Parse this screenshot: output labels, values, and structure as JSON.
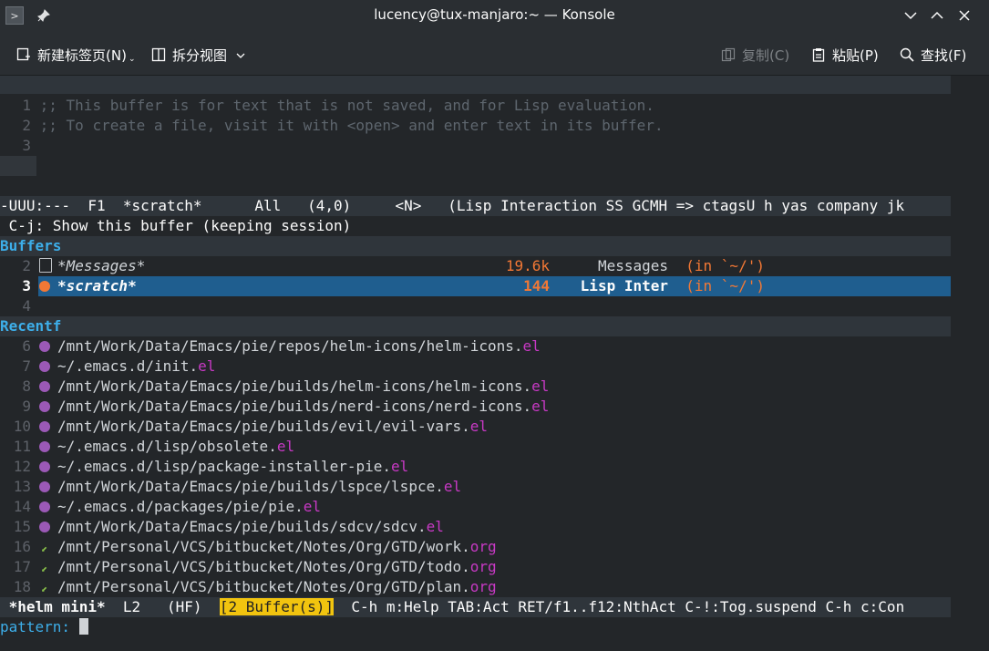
{
  "window": {
    "title": "lucency@tux-manjaro:~ — Konsole",
    "icons": [
      "terminal-icon",
      "pin-icon",
      "minimize-icon",
      "maximize-icon",
      "close-icon"
    ]
  },
  "toolbar": {
    "new_tab": "新建标签页(N)",
    "split_view": "拆分视图",
    "copy": "复制(C)",
    "paste": "粘贴(P)",
    "find": "查找(F)"
  },
  "editor": {
    "lines": [
      {
        "num": "1",
        "text": ";; This buffer is for text that is not saved, and for Lisp evaluation."
      },
      {
        "num": "2",
        "text": ";; To create a file, visit it with <open> and enter text in its buffer."
      },
      {
        "num": "3",
        "text": ""
      }
    ],
    "modeline": "-UUU:---  F1  *scratch*      All   (4,0)     <N>   (Lisp Interaction SS GCMH => ctagsU h yas company jk",
    "hint": " C-j: Show this buffer (keeping session)"
  },
  "helm": {
    "buffers_header": "Buffers",
    "buffers": [
      {
        "num": "2",
        "name": "*Messages*",
        "size": "19.6k",
        "mode": "Messages",
        "dir": "(in `~/')"
      },
      {
        "num": "3",
        "name": "*scratch*",
        "size": "144",
        "mode": "Lisp Inter",
        "dir": "(in `~/')"
      }
    ],
    "blank_num": "4",
    "recentf_header": "Recentf",
    "recentf": [
      {
        "num": "6",
        "path": "/mnt/Work/Data/Emacs/pie/repos/helm-icons/helm-icons.",
        "ext": "el",
        "icon": "elisp-icon"
      },
      {
        "num": "7",
        "path": "~/.emacs.d/init.",
        "ext": "el",
        "icon": "elisp-icon"
      },
      {
        "num": "8",
        "path": "/mnt/Work/Data/Emacs/pie/builds/helm-icons/helm-icons.",
        "ext": "el",
        "icon": "elisp-icon"
      },
      {
        "num": "9",
        "path": "/mnt/Work/Data/Emacs/pie/builds/nerd-icons/nerd-icons.",
        "ext": "el",
        "icon": "elisp-icon"
      },
      {
        "num": "10",
        "path": "/mnt/Work/Data/Emacs/pie/builds/evil/evil-vars.",
        "ext": "el",
        "icon": "elisp-icon"
      },
      {
        "num": "11",
        "path": "~/.emacs.d/lisp/obsolete.",
        "ext": "el",
        "icon": "elisp-icon"
      },
      {
        "num": "12",
        "path": "~/.emacs.d/lisp/package-installer-pie.",
        "ext": "el",
        "icon": "elisp-icon"
      },
      {
        "num": "13",
        "path": "/mnt/Work/Data/Emacs/pie/builds/lspce/lspce.",
        "ext": "el",
        "icon": "elisp-icon"
      },
      {
        "num": "14",
        "path": "~/.emacs.d/packages/pie/pie.",
        "ext": "el",
        "icon": "elisp-icon"
      },
      {
        "num": "15",
        "path": "/mnt/Work/Data/Emacs/pie/builds/sdcv/sdcv.",
        "ext": "el",
        "icon": "elisp-icon"
      },
      {
        "num": "16",
        "path": "/mnt/Personal/VCS/bitbucket/Notes/Org/GTD/work.",
        "ext": "org",
        "icon": "org-icon"
      },
      {
        "num": "17",
        "path": "/mnt/Personal/VCS/bitbucket/Notes/Org/GTD/todo.",
        "ext": "org",
        "icon": "org-icon"
      },
      {
        "num": "18",
        "path": "/mnt/Personal/VCS/bitbucket/Notes/Org/GTD/plan.",
        "ext": "org",
        "icon": "org-icon"
      }
    ],
    "modeline_name": " *helm mini*",
    "modeline_l": "L2",
    "modeline_hf": "(HF)",
    "modeline_count": "[2 Buffer(s)]",
    "modeline_help": "C-h m:Help TAB:Act RET/f1..f12:NthAct C-!:Tog.suspend C-h c:Con",
    "prompt": "pattern: "
  },
  "colors": {
    "background": "#232629",
    "selection": "#1f5e8f",
    "header": "#3daee9",
    "extension": "#c839c5",
    "dir": "#f27835",
    "count_badge": "#f1c40f"
  }
}
